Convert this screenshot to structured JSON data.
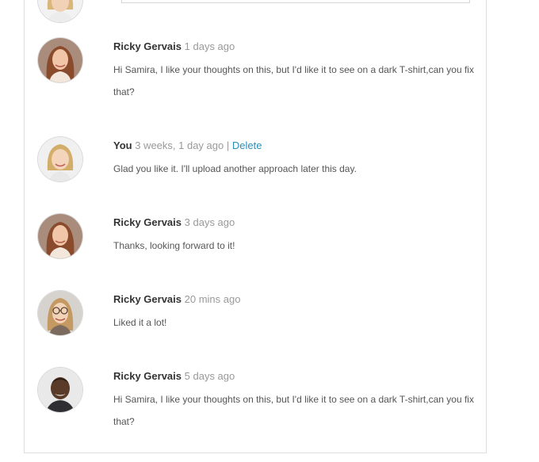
{
  "colors": {
    "author": "#333333",
    "timestamp": "#999999",
    "body_text": "#555555",
    "link": "#2a8fbd",
    "border": "#dedede"
  },
  "comments": [
    {
      "author": "Ricky Gervais",
      "time": "1 days ago",
      "text": "Hi Samira, I like your thoughts on this, but I'd like it to see on a dark T-shirt,can you fix that?",
      "avatar_icon": "woman-red-hair-avatar"
    },
    {
      "author": "You",
      "time": "3 weeks, 1 day ago",
      "separator": "|",
      "action_label": "Delete",
      "text": "Glad you like it. I'll upload another approach later this day.",
      "avatar_icon": "woman-blonde-avatar"
    },
    {
      "author": "Ricky Gervais",
      "time": "3 days ago",
      "text": "Thanks, looking forward to it!",
      "avatar_icon": "woman-red-hair-avatar"
    },
    {
      "author": "Ricky Gervais",
      "time": "20 mins ago",
      "text": "Liked it a lot!",
      "avatar_icon": "woman-glasses-avatar"
    },
    {
      "author": "Ricky Gervais",
      "time": "5 days ago",
      "text": "Hi Samira, I like your thoughts on this, but I'd like it to see on a dark T-shirt,can you fix that?",
      "avatar_icon": "man-avatar"
    }
  ]
}
